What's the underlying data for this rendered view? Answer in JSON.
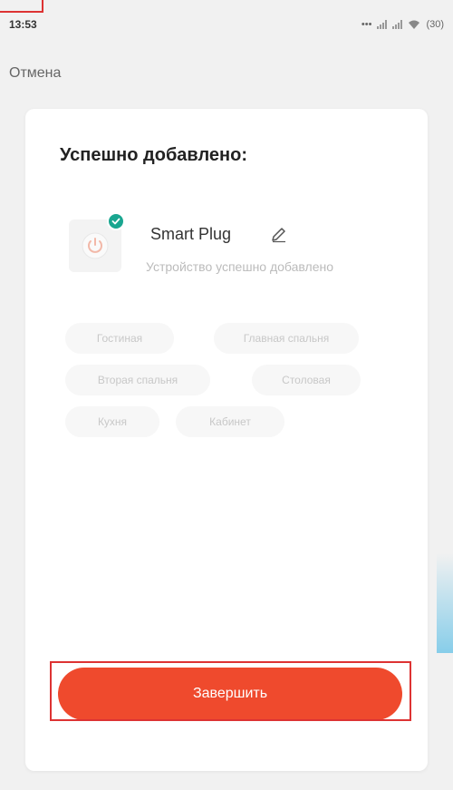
{
  "status_bar": {
    "time": "13:53",
    "battery": "(30)"
  },
  "header": {
    "cancel_label": "Отмена"
  },
  "card": {
    "title": "Успешно добавлено:",
    "device": {
      "name": "Smart Plug",
      "status": "Устройство успешно добавлено"
    },
    "rooms": [
      {
        "label": "Гостиная"
      },
      {
        "label": "Главная спальня"
      },
      {
        "label": "Вторая спальня"
      },
      {
        "label": "Столовая"
      },
      {
        "label": "Кухня"
      },
      {
        "label": "Кабинет"
      }
    ],
    "finish_label": "Завершить"
  },
  "colors": {
    "accent": "#ef4a2d",
    "success": "#1aa690",
    "annotation": "#dd3333"
  }
}
